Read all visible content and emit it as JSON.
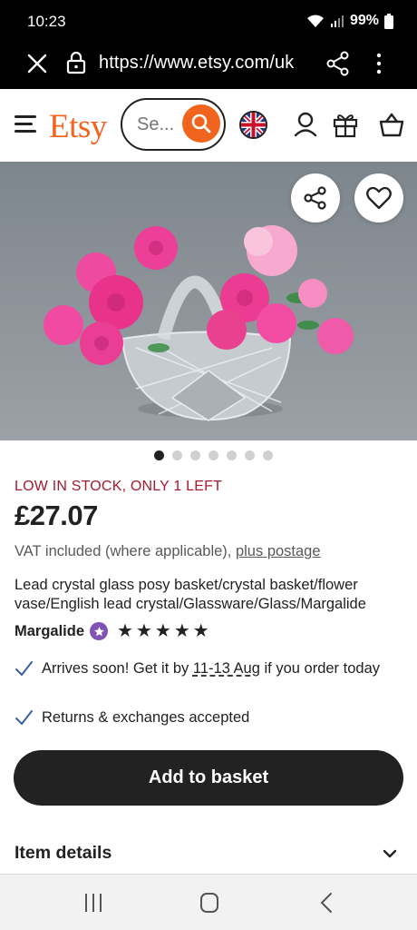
{
  "status_bar": {
    "time": "10:23",
    "battery": "99%"
  },
  "browser": {
    "url": "https://www.etsy.com/uk"
  },
  "header": {
    "logo": "Etsy",
    "search_placeholder": "Se..."
  },
  "listing": {
    "stock_notice": "LOW IN STOCK, ONLY 1 LEFT",
    "price": "£27.07",
    "vat_text": "VAT included (where applicable), ",
    "postage_link": "plus postage",
    "title": "Lead crystal glass posy basket/crystal basket/flower vase/English lead crystal/Glassware/Glass/Margalide",
    "shop_name": "Margalide",
    "rating_stars": 5,
    "stars": [
      "★",
      "★",
      "★",
      "★",
      "★"
    ],
    "arrival_prefix": "Arrives soon! Get it by ",
    "arrival_date": "11-13 Aug",
    "arrival_suffix": " if you order today",
    "returns": "Returns & exchanges accepted",
    "add_to_basket": "Add to basket",
    "item_details": "Item details",
    "image_count": 7,
    "active_image_index": 0
  },
  "colors": {
    "brand": "#f1641e",
    "stock": "#a61a2e",
    "button": "#222222",
    "star_seller": "#7f52b3"
  },
  "icons": [
    "close-icon",
    "lock-icon",
    "share-icon",
    "more-icon",
    "menu-icon",
    "search-icon",
    "uk-flag-icon",
    "account-icon",
    "gift-icon",
    "basket-icon",
    "heart-icon",
    "star-seller-icon",
    "check-icon",
    "chevron-down-icon"
  ]
}
